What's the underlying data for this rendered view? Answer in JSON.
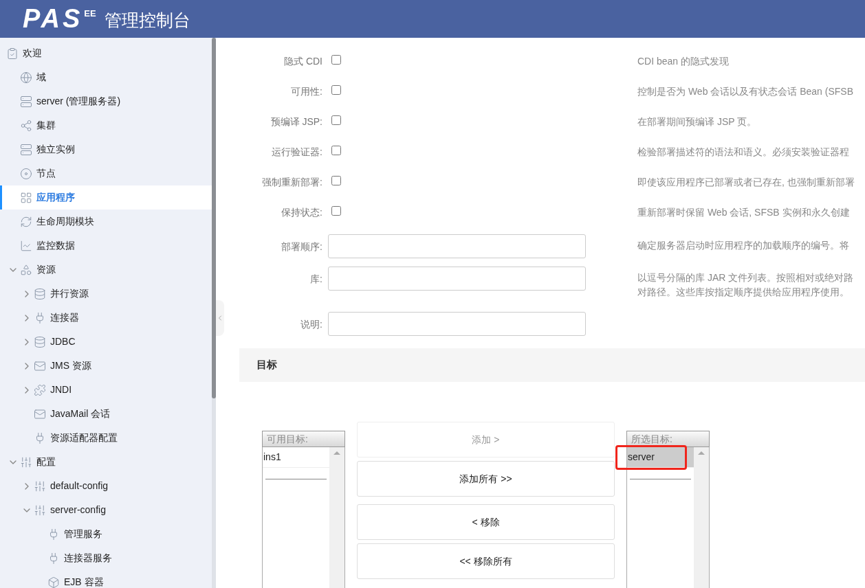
{
  "header": {
    "logo": "PAS",
    "logo_sup": "EE",
    "title": "管理控制台"
  },
  "sidebar": {
    "items": [
      {
        "label": "欢迎",
        "kind": "welcome",
        "selected": false
      },
      {
        "label": "域",
        "kind": "globe",
        "selected": false
      },
      {
        "label": "server (管理服务器)",
        "kind": "server",
        "selected": false
      },
      {
        "label": "集群",
        "kind": "cluster",
        "selected": false
      },
      {
        "label": "独立实例",
        "kind": "server",
        "selected": false
      },
      {
        "label": "节点",
        "kind": "disc",
        "selected": false
      },
      {
        "label": "应用程序",
        "kind": "apps",
        "selected": true
      },
      {
        "label": "生命周期模块",
        "kind": "cycle",
        "selected": false
      },
      {
        "label": "监控数据",
        "kind": "chart",
        "selected": false
      },
      {
        "label": "资源",
        "kind": "shapes",
        "selected": false,
        "expanded": true,
        "children": [
          {
            "label": "并行资源",
            "kind": "database",
            "selected": false,
            "expanded": false
          },
          {
            "label": "连接器",
            "kind": "plug",
            "selected": false,
            "expanded": false
          },
          {
            "label": "JDBC",
            "kind": "database",
            "selected": false,
            "expanded": false
          },
          {
            "label": "JMS 资源",
            "kind": "mail",
            "selected": false,
            "expanded": false
          },
          {
            "label": "JNDI",
            "kind": "puzzle",
            "selected": false,
            "expanded": false
          },
          {
            "label": "JavaMail 会话",
            "kind": "mail",
            "selected": false
          },
          {
            "label": "资源适配器配置",
            "kind": "plug",
            "selected": false
          }
        ]
      },
      {
        "label": "配置",
        "kind": "sliders",
        "selected": false,
        "expanded": true,
        "children": [
          {
            "label": "default-config",
            "kind": "sliders",
            "selected": false,
            "expanded": false
          },
          {
            "label": "server-config",
            "kind": "sliders",
            "selected": false,
            "expanded": true,
            "children": [
              {
                "label": "管理服务",
                "kind": "plug",
                "selected": false
              },
              {
                "label": "连接器服务",
                "kind": "plug",
                "selected": false
              },
              {
                "label": "EJB 容器",
                "kind": "box",
                "selected": false
              }
            ]
          }
        ]
      }
    ]
  },
  "form": {
    "rows": [
      {
        "label": "隐式 CDI",
        "kind": "checkbox",
        "checked": false,
        "description": "CDI bean 的隐式发现"
      },
      {
        "label": "可用性:",
        "kind": "checkbox",
        "checked": false,
        "description": "控制是否为 Web 会话以及有状态会话 Bean (SFSB"
      },
      {
        "label": "预编译 JSP:",
        "kind": "checkbox",
        "checked": false,
        "description": "在部署期间预编译 JSP 页。"
      },
      {
        "label": "运行验证器:",
        "kind": "checkbox",
        "checked": false,
        "description": "检验部署描述符的语法和语义。必须安装验证器程"
      },
      {
        "label": "强制重新部署:",
        "kind": "checkbox",
        "checked": false,
        "description": "即使该应用程序已部署或者已存在, 也强制重新部署"
      },
      {
        "label": "保持状态:",
        "kind": "checkbox",
        "checked": false,
        "description": "重新部署时保留 Web 会话, SFSB 实例和永久创建"
      },
      {
        "label": "部署顺序:",
        "kind": "text",
        "description": "确定服务器启动时应用程序的加载顺序的编号。将"
      },
      {
        "label": "库:",
        "kind": "text",
        "description": "以逗号分隔的库 JAR 文件列表。按照相对或绝对路",
        "description_more": "对路径。这些库按指定顺序提供给应用程序使用。"
      },
      {
        "label": "说明:",
        "kind": "text"
      }
    ]
  },
  "targets": {
    "title": "目标",
    "available": {
      "header": "可用目标:",
      "items": [
        {
          "label": "ins1",
          "selected": false,
          "annotated": false
        }
      ]
    },
    "buttons": [
      {
        "label": "添加 >",
        "disabled": true
      },
      {
        "label": "添加所有 >>",
        "disabled": false
      },
      {
        "label": "< 移除",
        "disabled": false
      },
      {
        "label": "<< 移除所有",
        "disabled": false
      }
    ],
    "chosen": {
      "header": "所选目标:",
      "items": [
        {
          "label": "server",
          "selected": true,
          "annotated": true
        }
      ]
    }
  }
}
